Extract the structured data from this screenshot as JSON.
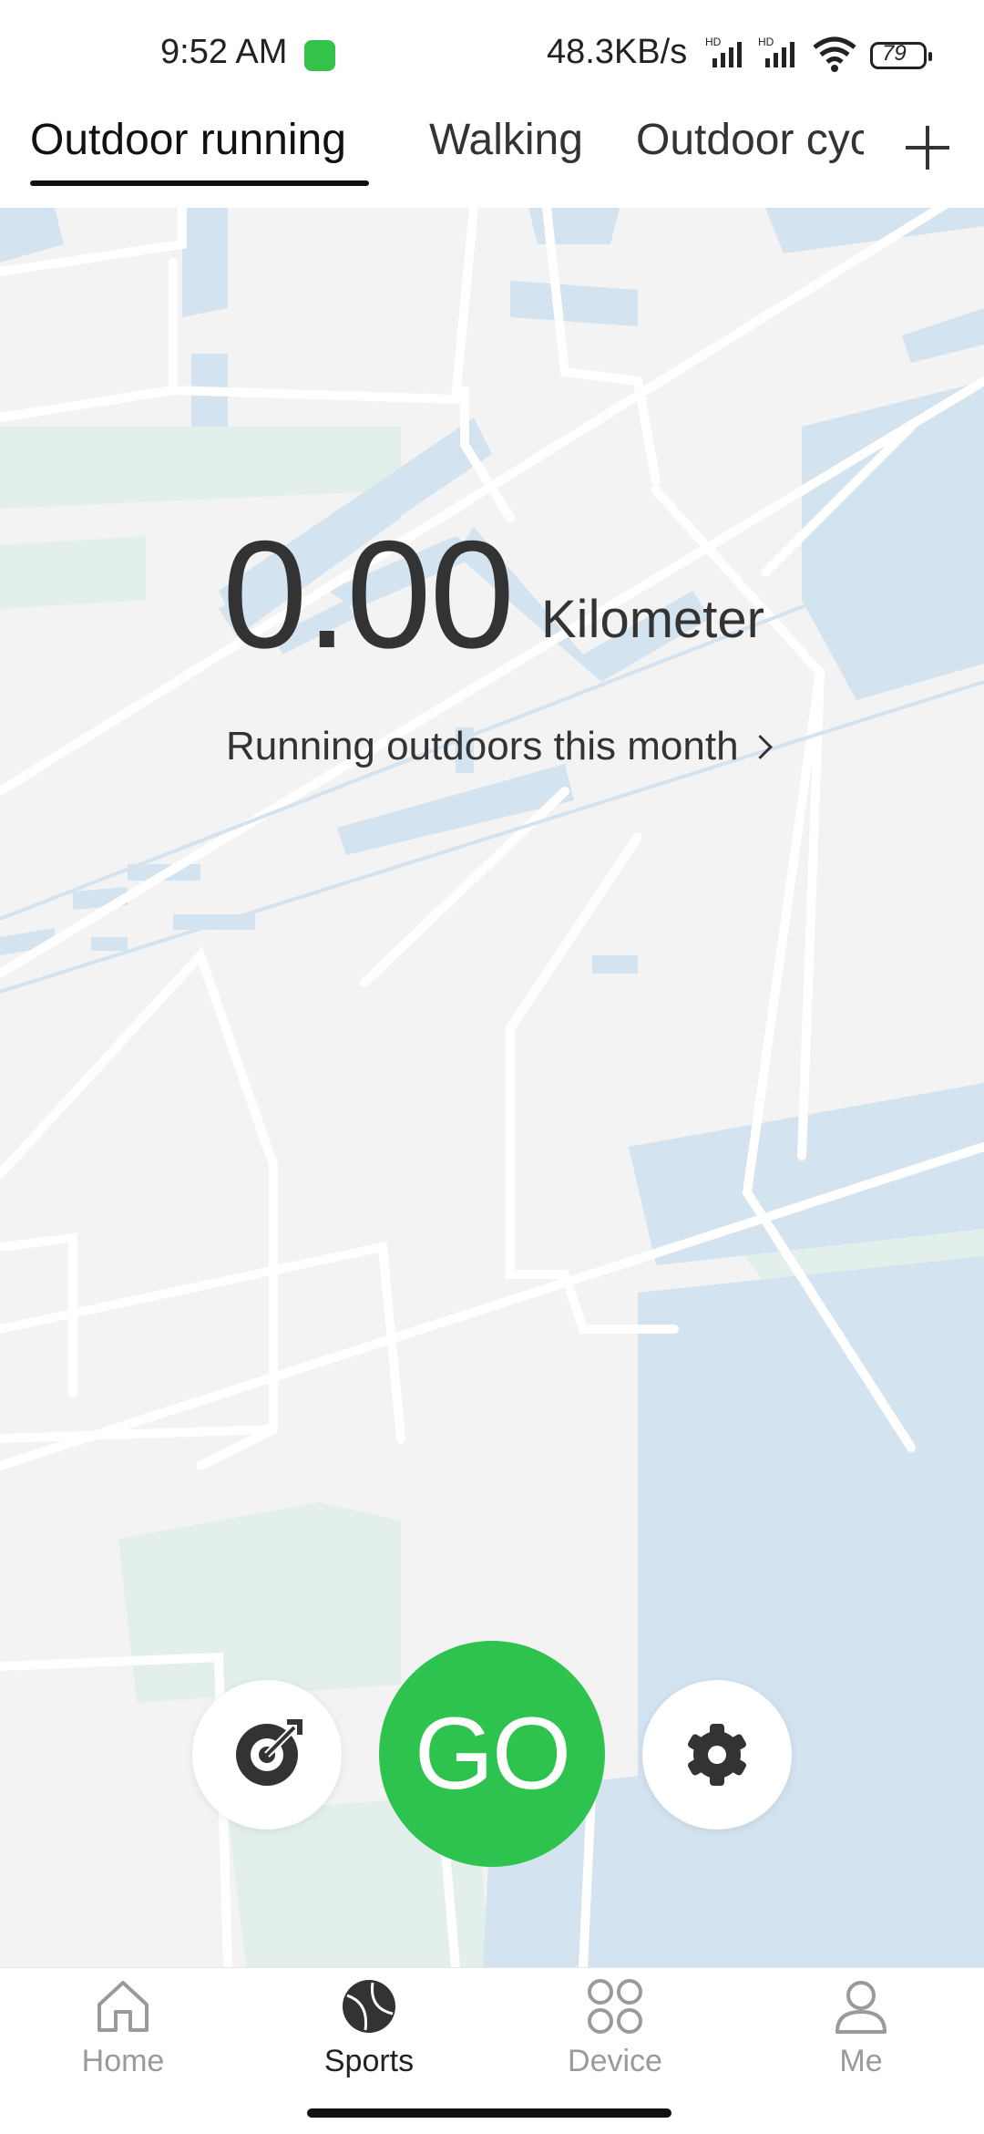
{
  "status_bar": {
    "time": "9:52 AM",
    "network_speed": "48.3KB/s",
    "battery": "79",
    "icons": [
      "app-notification-icon",
      "hd-signal-icon",
      "hd-signal-icon",
      "wifi-icon",
      "battery-icon"
    ]
  },
  "tabs": {
    "items": [
      {
        "label": "Outdoor running",
        "active": true
      },
      {
        "label": "Walking",
        "active": false
      },
      {
        "label": "Outdoor cyc",
        "active": false
      }
    ],
    "add_icon": "plus-icon"
  },
  "summary": {
    "distance": "0.00",
    "unit": "Kilometer",
    "month_link": "Running outdoors this month"
  },
  "actions": {
    "go_label": "GO",
    "left_icon": "target-icon",
    "right_icon": "gear-icon",
    "go_color": "#2EC24E"
  },
  "bottom_nav": {
    "items": [
      {
        "label": "Home",
        "icon": "home-icon",
        "active": false
      },
      {
        "label": "Sports",
        "icon": "ball-icon",
        "active": true
      },
      {
        "label": "Device",
        "icon": "device-icon",
        "active": false
      },
      {
        "label": "Me",
        "icon": "person-icon",
        "active": false
      }
    ]
  }
}
